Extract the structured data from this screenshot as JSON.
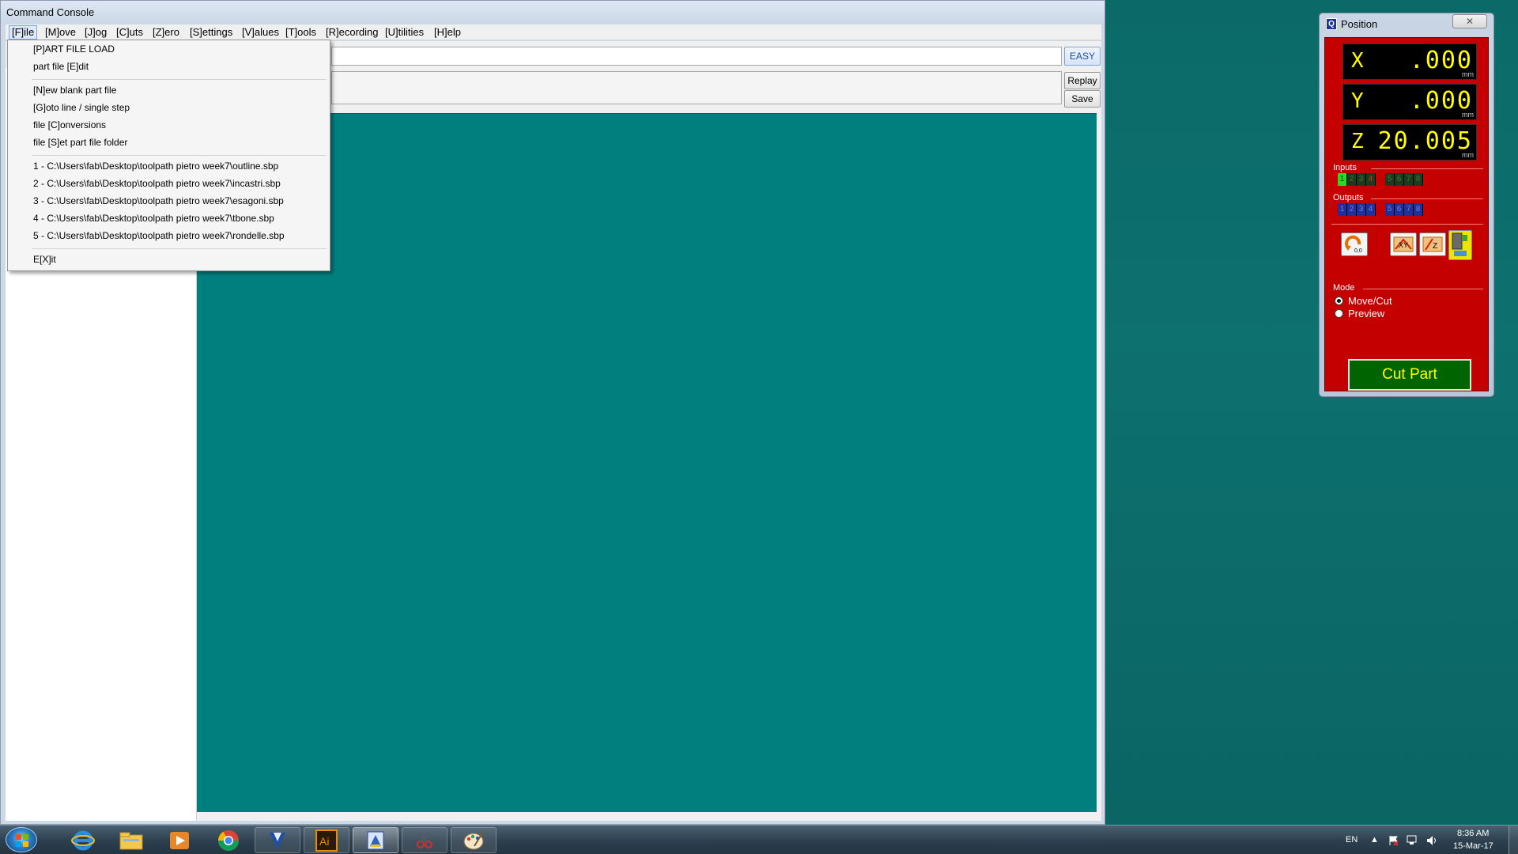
{
  "console": {
    "title": "Command Console",
    "menu": [
      "[F]ile",
      "[M]ove",
      "[J]og",
      "[C]uts",
      "[Z]ero",
      "[S]ettings",
      "[V]alues",
      "[T]ools",
      "[R]ecording",
      "[U]tilities",
      "[H]elp"
    ],
    "buttons": {
      "easy": "EASY",
      "replay": "Replay",
      "save": "Save"
    }
  },
  "file_menu": {
    "group1": [
      "[P]ART FILE LOAD",
      "part file [E]dit"
    ],
    "group2": [
      "[N]ew blank part file",
      "[G]oto line / single step",
      "file [C]onversions",
      "file [S]et part file folder"
    ],
    "recent": [
      "1 - C:\\Users\\fab\\Desktop\\toolpath pietro week7\\outline.sbp",
      "2 - C:\\Users\\fab\\Desktop\\toolpath pietro week7\\incastri.sbp",
      "3 - C:\\Users\\fab\\Desktop\\toolpath pietro week7\\esagoni.sbp",
      "4 - C:\\Users\\fab\\Desktop\\toolpath pietro week7\\tbone.sbp",
      "5 - C:\\Users\\fab\\Desktop\\toolpath pietro week7\\rondelle.sbp"
    ],
    "exit": "E[X]it"
  },
  "position": {
    "title": "Position",
    "icon_letter": "Q",
    "axes": [
      {
        "axis": "X",
        "value": ".000",
        "unit": "mm"
      },
      {
        "axis": "Y",
        "value": ".000",
        "unit": "mm"
      },
      {
        "axis": "Z",
        "value": "20.005",
        "unit": "mm"
      }
    ],
    "inputs_label": "Inputs",
    "inputs": [
      {
        "n": "1",
        "state": "on"
      },
      {
        "n": "2",
        "state": "off"
      },
      {
        "n": "3",
        "state": "off"
      },
      {
        "n": "4",
        "state": "red"
      },
      {
        "n": "5",
        "state": "off"
      },
      {
        "n": "6",
        "state": "off"
      },
      {
        "n": "7",
        "state": "off"
      },
      {
        "n": "8",
        "state": "off"
      }
    ],
    "outputs_label": "Outputs",
    "outputs": [
      "1",
      "2",
      "3",
      "4",
      "5",
      "6",
      "7",
      "8"
    ],
    "tool_icons": [
      "zero-to-zero-icon",
      "zero-xy-icon",
      "zero-z-icon",
      "keypad-icon"
    ],
    "mode_label": "Mode",
    "modes": [
      {
        "label": "Move/Cut",
        "checked": true
      },
      {
        "label": "Preview",
        "checked": false
      }
    ],
    "cut_part": "Cut Part"
  },
  "taskbar": {
    "apps": [
      "internet-explorer-icon",
      "file-explorer-icon",
      "media-player-icon",
      "chrome-icon",
      "vcarve-icon",
      "illustrator-icon",
      "partworks-icon",
      "cut-tool-icon",
      "paint-icon"
    ],
    "language": "EN",
    "time": "8:36 AM",
    "date": "15-Mar-17"
  },
  "colors": {
    "desktop": "#0b6a68",
    "canvas": "#007f7e",
    "position_panel": "#c40000",
    "dro_text": "#ffff00",
    "cut_part_bg": "#006400"
  }
}
